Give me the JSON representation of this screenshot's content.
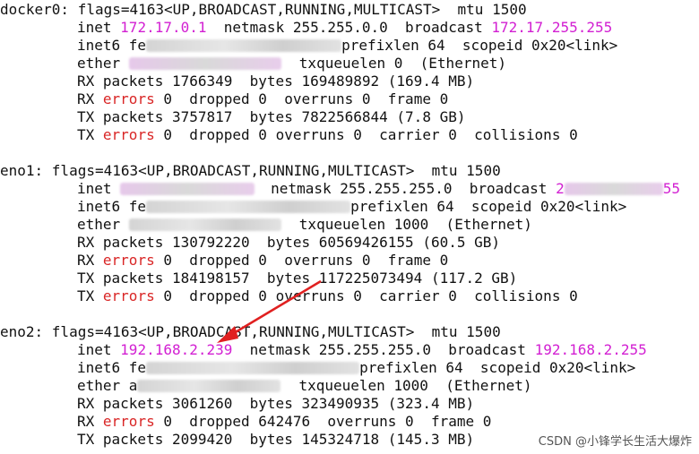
{
  "docker0": {
    "header": "docker0: flags=4163<UP,BROADCAST,RUNNING,MULTICAST>  mtu 1500",
    "inet_label": "inet ",
    "inet_ip": "172.17.0.1",
    "netmask": "  netmask 255.255.0.0  broadcast ",
    "broadcast": "172.17.255.255",
    "inet6_label": "inet6 fe",
    "inet6_tail": "prefixlen 64  scopeid 0x20<link>",
    "ether_label": "ether ",
    "ether_tail": "txqueuelen 0  (Ethernet)",
    "rx_packets": "RX packets 1766349  bytes 169489892 (169.4 MB)",
    "rx_errors_pre": "RX ",
    "rx_errors_word": "errors",
    "rx_errors_post": " 0  dropped 0  overruns 0  frame 0",
    "tx_packets": "TX packets 3757817  bytes 7822566844 (7.8 GB)",
    "tx_errors_pre": "TX ",
    "tx_errors_word": "errors",
    "tx_errors_post": " 0  dropped 0 overruns 0  carrier 0  collisions 0"
  },
  "eno1": {
    "header": "eno1: flags=4163<UP,BROADCAST,RUNNING,MULTICAST>  mtu 1500",
    "inet_label": "inet ",
    "netmask": "netmask 255.255.255.0  broadcast ",
    "broadcast_prefix": "2",
    "broadcast_suffix": "55",
    "inet6_label": "inet6 fe",
    "inet6_tail": "prefixlen 64  scopeid 0x20<link>",
    "ether_label": "ether ",
    "ether_tail": "txqueuelen 1000  (Ethernet)",
    "rx_packets": "RX packets 130792220  bytes 60569426155 (60.5 GB)",
    "rx_errors_pre": "RX ",
    "rx_errors_word": "errors",
    "rx_errors_post": " 0  dropped 0  overruns 0  frame 0",
    "tx_packets": "TX packets 184198157  bytes 117225073494 (117.2 GB)",
    "tx_errors_pre": "TX ",
    "tx_errors_word": "errors",
    "tx_errors_post": " 0  dropped 0 overruns 0  carrier 0  collisions 0"
  },
  "eno2": {
    "header": "eno2: flags=4163<UP,BROADCAST,RUNNING,MULTICAST>  mtu 1500",
    "inet_label": "inet ",
    "inet_ip": "192.168.2.239",
    "netmask": "  netmask 255.255.255.0  broadcast ",
    "broadcast": "192.168.2.255",
    "inet6_label": "inet6 fe",
    "inet6_tail": "prefixlen 64  scopeid 0x20<link>",
    "ether_label": "ether a",
    "ether_tail": "txqueuelen 1000  (Ethernet)",
    "rx_packets": "RX packets 3061260  bytes 323490935 (323.4 MB)",
    "rx_errors_pre": "RX ",
    "rx_errors_word": "errors",
    "rx_errors_post": " 0  dropped 642476  overruns 0  frame 0",
    "tx_packets": "TX packets 2099420  bytes 145324718 (145.3 MB)"
  },
  "watermark": "CSDN @小锋学长生活大爆炸",
  "colors": {
    "highlight": "#d21fd2",
    "error_word": "#d92626",
    "arrow": "#e02020"
  }
}
